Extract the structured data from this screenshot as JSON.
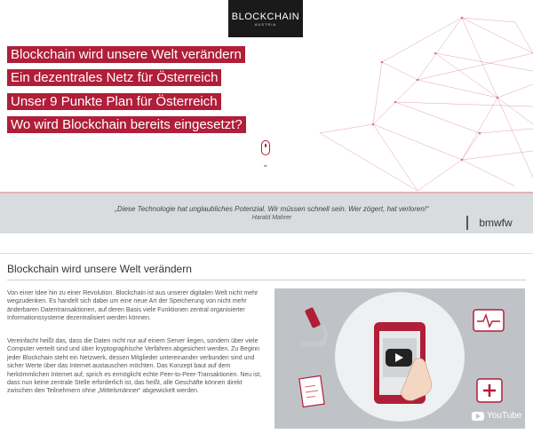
{
  "logo": {
    "main": "BLOCKCHAIN",
    "sub": "AUSTRIA"
  },
  "hero": {
    "headlines": [
      "Blockchain wird unsere Welt verändern",
      "Ein dezentrales Netz für Österreich",
      "Unser 9 Punkte Plan für Österreich",
      "Wo wird Blockchain bereits eingesetzt?"
    ],
    "accent_color": "#b01e38"
  },
  "quote": {
    "text": "„Diese Technologie hat unglaubliches Potenzial. Wir müssen schnell sein. Wer zögert, hat verloren!“",
    "author": "Harald Mahrer",
    "partner_logo": "bmwfw"
  },
  "section": {
    "title": "Blockchain wird unsere Welt verändern",
    "paragraph1": "Von einer Idee hin zu einer Revolution. Blockchain ist aus unserer digitalen Welt nicht mehr wegzudenken. Es handelt sich dabei um eine neue Art der Speicherung von nicht mehr änderbaren Datentransaktionen, auf deren Basis viele Funktionen zentral organisierter Informationssysteme dezentralisiert werden können.",
    "paragraph2": "Vereinfacht heißt das, dass die Daten nicht nur auf einem Server liegen, sondern über viele Computer verteilt sind und über kryptographische Verfahren abgesichert werden. Zu Beginn jeder Blockchain steht ein Netzwerk, dessen Mitglieder untereinander verbunden sind und sicher Werte über das Internet austauschen möchten. Das Konzept baut auf dem herkömmlichen Internet auf, sprich es ermöglicht echte Peer-to-Peer-Transaktionen. Neu ist, dass nun keine zentrale Stelle erforderlich ist, das heißt, alle Geschäfte können direkt zwischen den Teilnehmern ohne „Mittelsmänner“ abgewickelt werden."
  },
  "video": {
    "provider": "YouTube",
    "icons": [
      "microscope-icon",
      "heart-monitor-icon",
      "document-icon",
      "medical-kit-icon",
      "tablet-icon",
      "hand-icon"
    ]
  }
}
